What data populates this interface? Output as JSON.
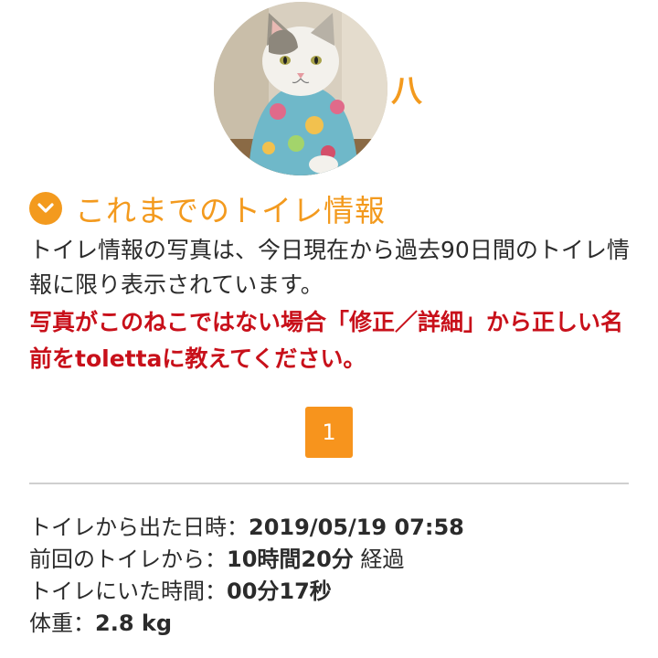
{
  "profile": {
    "cat_name": "八",
    "avatar_icon": "cat-photo"
  },
  "section": {
    "icon": "chevron-down-icon",
    "title": "これまでのトイレ情報",
    "description": "トイレ情報の写真は、今日現在から過去90日間のトイレ情報に限り表示されています。",
    "warning": "写真がこのねこではない場合「修正／詳細」から正しい名前をtolettaに教えてください。"
  },
  "pagination": {
    "current_page": "1"
  },
  "record": {
    "exit_time_label": "トイレから出た日時：",
    "exit_time_value": "2019/05/19 07:58",
    "since_last_label": "前回のトイレから：",
    "since_last_value": "10時間20分",
    "since_last_suffix": " 経過",
    "duration_label": "トイレにいた時間：",
    "duration_value": "00分17秒",
    "weight_label": "体重：",
    "weight_value": "2.8 kg"
  },
  "colors": {
    "accent": "#f39a1e",
    "warning": "#c8101a",
    "divider": "#cfcfcf"
  }
}
